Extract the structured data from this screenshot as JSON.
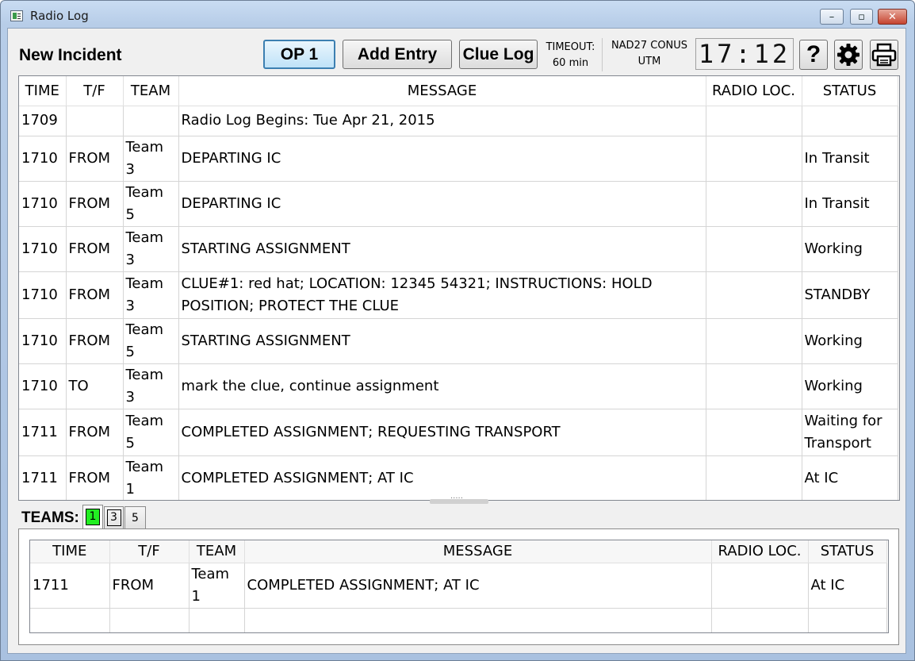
{
  "window": {
    "title": "Radio Log",
    "minimize": "–",
    "maximize": "▫",
    "close": "✕"
  },
  "toolbar": {
    "incident_name": "New Incident",
    "op_label": "OP 1",
    "add_entry_label": "Add Entry",
    "clue_log_label": "Clue Log",
    "timeout_label": "TIMEOUT:",
    "timeout_value": "60 min",
    "datum": "NAD27 CONUS",
    "coord_format": "UTM",
    "clock": "17:12",
    "help_label": "?",
    "settings_icon": "gear-icon",
    "print_icon": "printer-icon"
  },
  "columns": [
    "TIME",
    "T/F",
    "TEAM",
    "MESSAGE",
    "RADIO LOC.",
    "STATUS"
  ],
  "log_rows": [
    {
      "time": "1709",
      "tf": "",
      "team": "",
      "message": "Radio Log Begins: Tue Apr 21, 2015",
      "radio_loc": "",
      "status": ""
    },
    {
      "time": "1710",
      "tf": "FROM",
      "team": "Team 3",
      "message": "DEPARTING IC",
      "radio_loc": "",
      "status": "In Transit"
    },
    {
      "time": "1710",
      "tf": "FROM",
      "team": "Team 5",
      "message": "DEPARTING IC",
      "radio_loc": "",
      "status": "In Transit"
    },
    {
      "time": "1710",
      "tf": "FROM",
      "team": "Team 3",
      "message": "STARTING ASSIGNMENT",
      "radio_loc": "",
      "status": "Working"
    },
    {
      "time": "1710",
      "tf": "FROM",
      "team": "Team 3",
      "message": "CLUE#1: red hat; LOCATION: 12345 54321; INSTRUCTIONS: HOLD POSITION; PROTECT THE CLUE",
      "radio_loc": "",
      "status": "STANDBY"
    },
    {
      "time": "1710",
      "tf": "FROM",
      "team": "Team 5",
      "message": "STARTING ASSIGNMENT",
      "radio_loc": "",
      "status": "Working"
    },
    {
      "time": "1710",
      "tf": "TO",
      "team": "Team 3",
      "message": "mark the clue, continue assignment",
      "radio_loc": "",
      "status": "Working"
    },
    {
      "time": "1711",
      "tf": "FROM",
      "team": "Team 5",
      "message": "COMPLETED ASSIGNMENT; REQUESTING TRANSPORT",
      "radio_loc": "",
      "status": "Waiting for Transport"
    },
    {
      "time": "1711",
      "tf": "FROM",
      "team": "Team 1",
      "message": "COMPLETED ASSIGNMENT; AT IC",
      "radio_loc": "",
      "status": "At IC"
    },
    {
      "time": "",
      "tf": "",
      "team": "",
      "message": "",
      "radio_loc": "",
      "status": ""
    }
  ],
  "teams": {
    "label": "TEAMS:",
    "tabs": [
      "1",
      "3",
      "5"
    ],
    "active_color": "#22ee22",
    "rows": [
      {
        "time": "1711",
        "tf": "FROM",
        "team": "Team 1",
        "message": "COMPLETED ASSIGNMENT; AT IC",
        "radio_loc": "",
        "status": "At IC"
      },
      {
        "time": "",
        "tf": "",
        "team": "",
        "message": "",
        "radio_loc": "",
        "status": ""
      }
    ]
  }
}
